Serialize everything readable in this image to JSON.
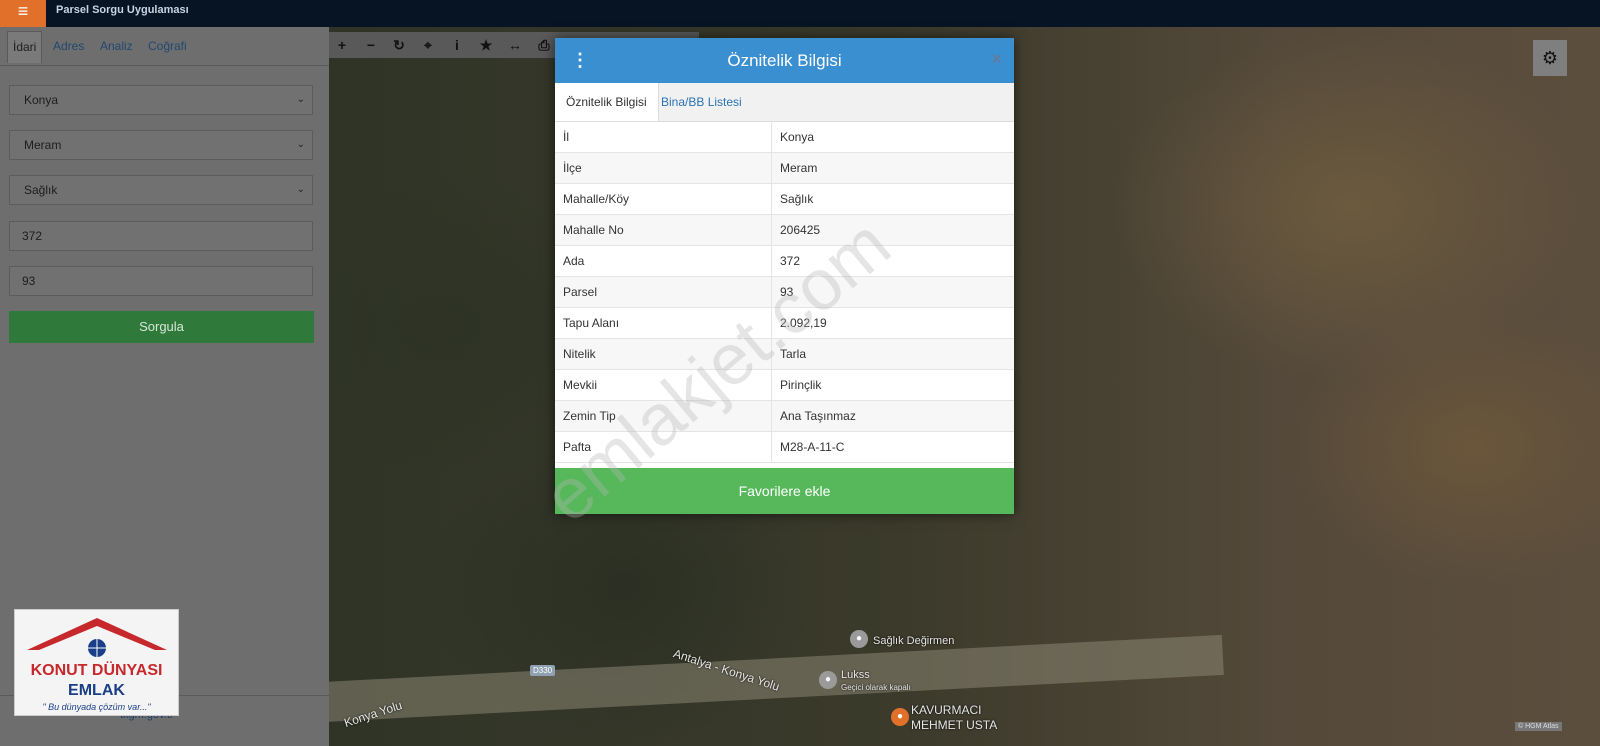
{
  "app": {
    "title": "Parsel Sorgu Uygulaması",
    "menu_icon": "≡"
  },
  "sidebar": {
    "tabs": [
      "İdari",
      "Adres",
      "Analiz",
      "Coğrafi"
    ],
    "fields": {
      "il": "Konya",
      "ilce": "Meram",
      "mahalle": "Sağlık",
      "ada": "372",
      "parsel": "93"
    },
    "query_button": "Sorgula",
    "footer_link": "tkgm.gov.tr"
  },
  "logo": {
    "line1": "KONUT DÜNYASI",
    "line2": "EMLAK",
    "line3": "\" Bu dünyada çözüm var...\""
  },
  "toolbar": {
    "icons": [
      "plus-icon",
      "minus-icon",
      "refresh-icon",
      "locate-icon",
      "info-icon",
      "star-icon",
      "measure-icon",
      "print-icon"
    ]
  },
  "map": {
    "labels": {
      "poi1": "Sağlık Değirmen",
      "poi2": "Lukss",
      "poi2_sub": "Geçici olarak kapalı",
      "poi3": "KAVURMACI",
      "poi3_sub": "MEHMET USTA",
      "road1": "Antalya - Konya Yolu",
      "road2": "Konya Yolu",
      "road_badge": "D330"
    },
    "attribution": "© HGM Atlas"
  },
  "modal": {
    "title": "Öznitelik Bilgisi",
    "tabs": [
      "Öznitelik Bilgisi",
      "Bina/BB Listesi"
    ],
    "rows": [
      {
        "key": "İl",
        "value": "Konya"
      },
      {
        "key": "İlçe",
        "value": "Meram"
      },
      {
        "key": "Mahalle/Köy",
        "value": "Sağlık"
      },
      {
        "key": "Mahalle No",
        "value": "206425"
      },
      {
        "key": "Ada",
        "value": "372"
      },
      {
        "key": "Parsel",
        "value": "93"
      },
      {
        "key": "Tapu Alanı",
        "value": "2.092,19"
      },
      {
        "key": "Nitelik",
        "value": "Tarla"
      },
      {
        "key": "Mevkii",
        "value": "Pirinçlik"
      },
      {
        "key": "Zemin Tip",
        "value": "Ana Taşınmaz"
      },
      {
        "key": "Pafta",
        "value": "M28-A-11-C"
      }
    ],
    "favorite_button": "Favorilere ekle",
    "close": "×"
  },
  "watermark": "emlakjet.com"
}
